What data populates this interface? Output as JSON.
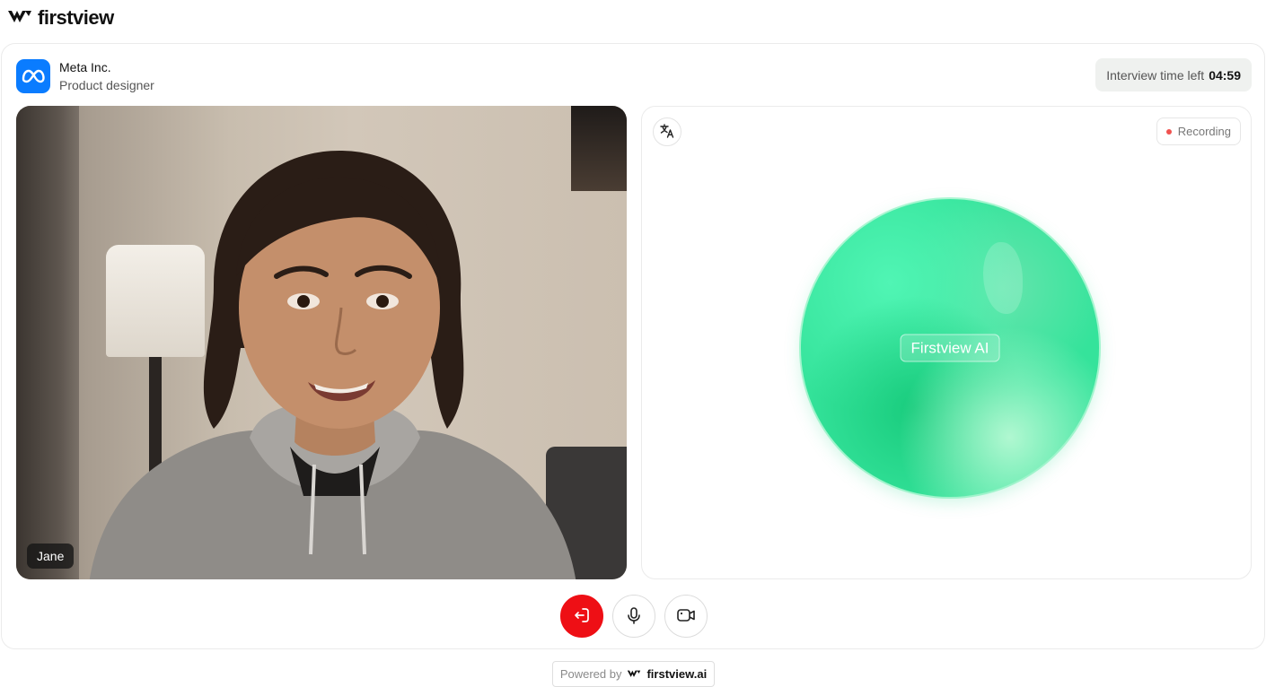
{
  "brand": {
    "name": "firstview",
    "icon": "firstview-logo-icon"
  },
  "company": {
    "name": "Meta Inc.",
    "role": "Product designer",
    "logo_icon": "meta-logo-icon",
    "logo_color": "#0a7cff"
  },
  "timer": {
    "label": "Interview time left",
    "value": "04:59"
  },
  "video": {
    "participant_name": "Jane"
  },
  "ai_panel": {
    "orb_label": "Firstview AI",
    "recording_label": "Recording",
    "translate_icon": "translate-icon",
    "orb_color": "#35e39b",
    "recording_dot_color": "#f0524f"
  },
  "controls": {
    "end_icon": "leave-call-icon",
    "mic_icon": "microphone-icon",
    "camera_icon": "camera-icon",
    "end_color": "#ee0f15"
  },
  "footer": {
    "powered_label": "Powered by",
    "powered_brand": "firstview.ai"
  }
}
